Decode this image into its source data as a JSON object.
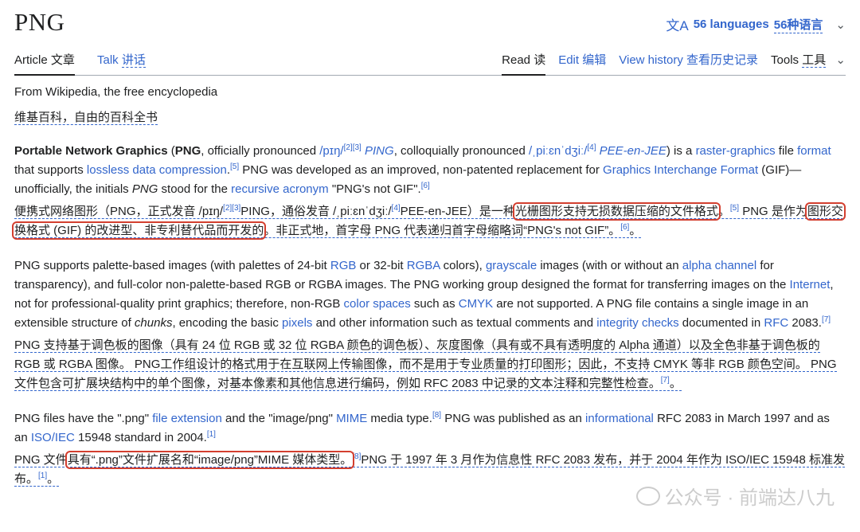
{
  "page": {
    "title": "PNG",
    "languages": {
      "count_label": "56 languages",
      "zh_label": "56种语言"
    }
  },
  "tabs": {
    "article": {
      "en": "Article",
      "zh": "文章"
    },
    "talk": {
      "en": "Talk",
      "zh": "讲话"
    },
    "read": {
      "en": "Read",
      "zh": "读"
    },
    "edit": {
      "en": "Edit",
      "zh": "编辑"
    },
    "history": {
      "en": "View history",
      "zh": "查看历史记录"
    },
    "tools": {
      "en": "Tools",
      "zh": "工具"
    }
  },
  "subtitle": {
    "en": "From Wikipedia, the free encyclopedia",
    "zh": "维基百科，自由的百科全书"
  },
  "p1": {
    "a": "Portable Network Graphics",
    "b": " (",
    "c": "PNG",
    "d": ", officially pronounced ",
    "e": "/pɪŋ/",
    "f": "[2][3]",
    "g": " PING",
    "h": ", colloquially pronounced ",
    "i": "/ˌpiːɛnˈdʒiː/",
    "j": "[4]",
    "k": " PEE-en-JEE",
    "l": ") is a ",
    "m": "raster-graphics",
    "n": " file ",
    "o": "format",
    "q": " that supports ",
    "r": "lossless data compression",
    "s": ".",
    "t": "[5]",
    "u": " PNG was developed as an improved, non-patented replacement for ",
    "v": "Graphics Interchange Format",
    "w": " (GIF)—unofficially, the initials ",
    "x": "PNG",
    "y": " stood for the ",
    "z": "recursive acronym",
    "aa": " \"PNG's not GIF\".",
    "ab": "[6]"
  },
  "zh1": {
    "a": "便携式网络图形（PNG，正式发音 /pɪŋ/",
    "b": "[2][3]",
    "c": "PING，通俗发音 /ˌpiːɛnˈdʒiː/",
    "d": "[4]",
    "e": "PEE-en-JEE）是一种",
    "f": "光栅图形支持无损数据压缩的文件格式",
    "g": "。",
    "h": "[5]",
    "i": " PNG 是作为",
    "j": "图形交换格式 (GIF) 的改进型、非专利替代品而开发的",
    "k": "。非正式地，首字母 PNG 代表递归首字母缩略词“PNG's not GIF”。",
    "l": "[6]",
    "m": "。"
  },
  "p2": {
    "a": "PNG supports palette-based images (with palettes of 24-bit ",
    "b": "RGB",
    "c": " or 32-bit ",
    "d": "RGBA",
    "e": " colors), ",
    "f": "grayscale",
    "g": " images (with or without an ",
    "h": "alpha channel",
    "i": " for transparency), and full-color non-palette-based RGB or RGBA images. The PNG working group designed the format for transferring images on the ",
    "j": "Internet",
    "k": ", not for professional-quality print graphics; therefore, non-RGB ",
    "l": "color spaces",
    "m": " such as ",
    "n": "CMYK",
    "o": " are not supported. A PNG file contains a single image in an extensible structure of ",
    "q": "chunks",
    "r": ", encoding the basic ",
    "s": "pixels",
    "t": " and other information such as textual comments and ",
    "u": "integrity checks",
    "v": " documented in ",
    "w": "RFC",
    "x": " 2083.",
    "y": "[7]"
  },
  "zh2": {
    "a": "PNG 支持基于调色板的图像（具有 24 位 RGB 或 32 位 RGBA 颜色的调色板）、灰度图像（具有或不具有透明度的 Alpha 通道）以及全色非基于调色板的 RGB 或 RGBA 图像。 PNG工作组设计的格式用于在互联网上传输图像，而不是用于专业质量的打印图形；因此，不支持 CMYK 等非 RGB 颜色空间。 PNG 文件包含可扩展块结构中的单个图像，对基本像素和其他信息进行编码，例如 RFC 2083 中记录的文本注释和完整性检查。",
    "b": "[7]",
    "c": "。"
  },
  "p3": {
    "a": "PNG files have the \".png\" ",
    "b": "file extension",
    "c": " and the \"image/png\" ",
    "d": "MIME",
    "e": " media type.",
    "f": "[8]",
    "g": " PNG was published as an ",
    "h": "informational",
    "i": " RFC 2083 in March 1997 and as an ",
    "j": "ISO/IEC",
    "k": " 15948 standard in 2004.",
    "l": "[1]"
  },
  "zh3": {
    "a": "PNG 文件",
    "b": "具有“.png”文件扩展名和“image/png”MIME 媒体类型。",
    "c": "[8]",
    "d": "PNG 于 1997 年 3 月作为信息性 RFC 2083 发布，并于 2004 年作为 ISO/IEC 15948 标准发布。",
    "e": "[1]",
    "f": "。"
  },
  "watermark": {
    "text": "公众号 · 前端达八九"
  },
  "colors": {
    "link": "#3366cc",
    "highlight": "#d33f2f",
    "text": "#202122"
  }
}
